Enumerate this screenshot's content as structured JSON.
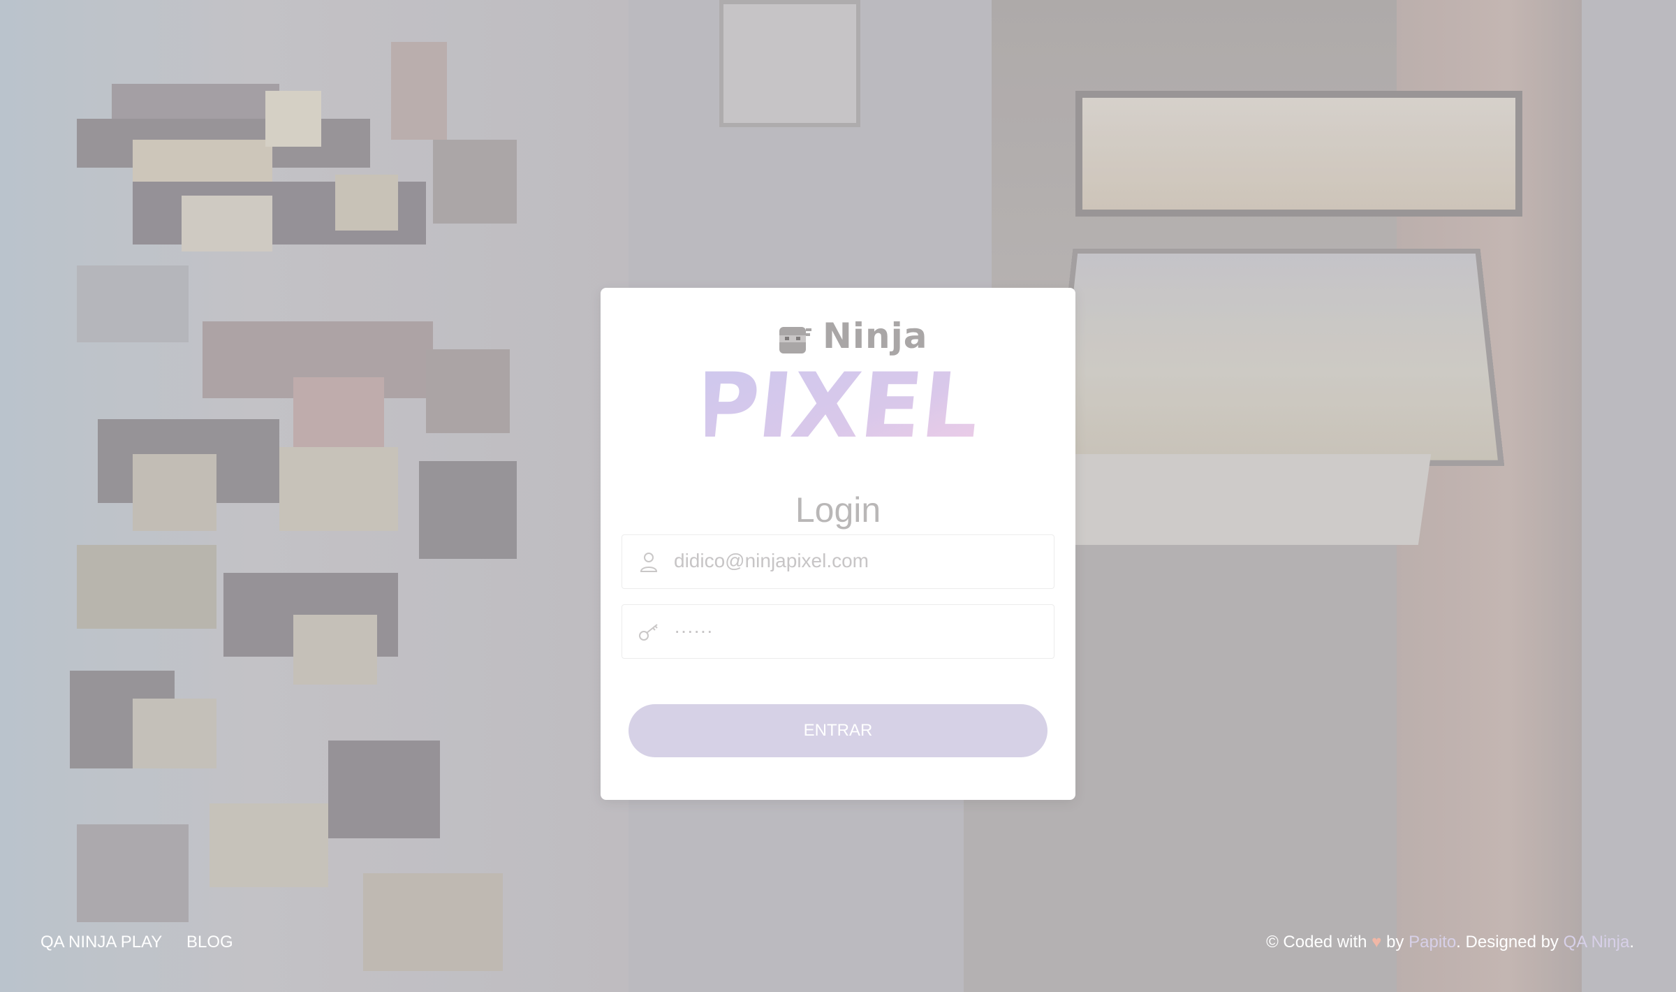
{
  "logo": {
    "top_word": "Ninja",
    "main_word": "PIXEL"
  },
  "login": {
    "title": "Login",
    "email_value": "didico@ninjapixel.com",
    "password_value": "······",
    "submit_label": "ENTRAR"
  },
  "footer": {
    "links": [
      "QA NINJA PLAY",
      "BLOG"
    ],
    "credits_prefix": "© Coded with",
    "heart": "♥",
    "credits_by": "by",
    "author": "Papito",
    "designed_by": ". Designed by",
    "designer": "QA Ninja",
    "end": "."
  },
  "colors": {
    "button_bg": "#d6d1e6",
    "link_accent": "#d7d0e8",
    "heart": "#f0b7a6",
    "title": "#b9b7b7"
  },
  "icons": {
    "email_field": "user-icon",
    "password_field": "key-icon"
  }
}
